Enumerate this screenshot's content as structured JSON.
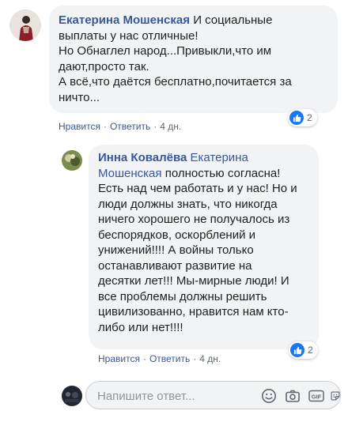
{
  "comment1": {
    "author": "Екатерина Мошенская",
    "text_lines": [
      "И социальные",
      "выплаты у нас отличные!",
      "Но Обнаглел народ...Привыкли,что им",
      "дают,просто так.",
      "А всё,что даётся бесплатно,почитается за",
      "ничто..."
    ],
    "actions": {
      "like": "Нравится",
      "reply": "Ответить",
      "time": "4 дн."
    },
    "reaction": {
      "icon": "like-icon",
      "count": "2"
    }
  },
  "comment2": {
    "author": "Инна Ковалёва",
    "mention_part1": "Екатерина",
    "mention_part2": "Мошенская",
    "text_first_suffix": "полностью согласна!",
    "text_lines": [
      "Есть над чем работать и у нас! Но и",
      "люди должны знать, что никогда",
      "ничего хорошего не получалось из",
      "беспорядков, оскорблений и",
      "унижений!!!! А войны только",
      "останавливают развитие на",
      "десятки лет!!! Мы-мирные люди! И",
      "все проблемы должны решить",
      "цивилизованно, нравится нам кто-",
      "либо или нет!!!!"
    ],
    "actions": {
      "like": "Нравится",
      "reply": "Ответить",
      "time": "4 дн."
    },
    "reaction": {
      "icon": "like-icon",
      "count": "2"
    }
  },
  "composer": {
    "placeholder": "Напишите ответ...",
    "icons": [
      "emoji-icon",
      "camera-icon",
      "gif-icon",
      "sticker-icon"
    ],
    "gif_label": "GIF"
  },
  "colors": {
    "link": "#385898",
    "bubble": "#f2f3f5",
    "like_blue": "#1877f2"
  }
}
